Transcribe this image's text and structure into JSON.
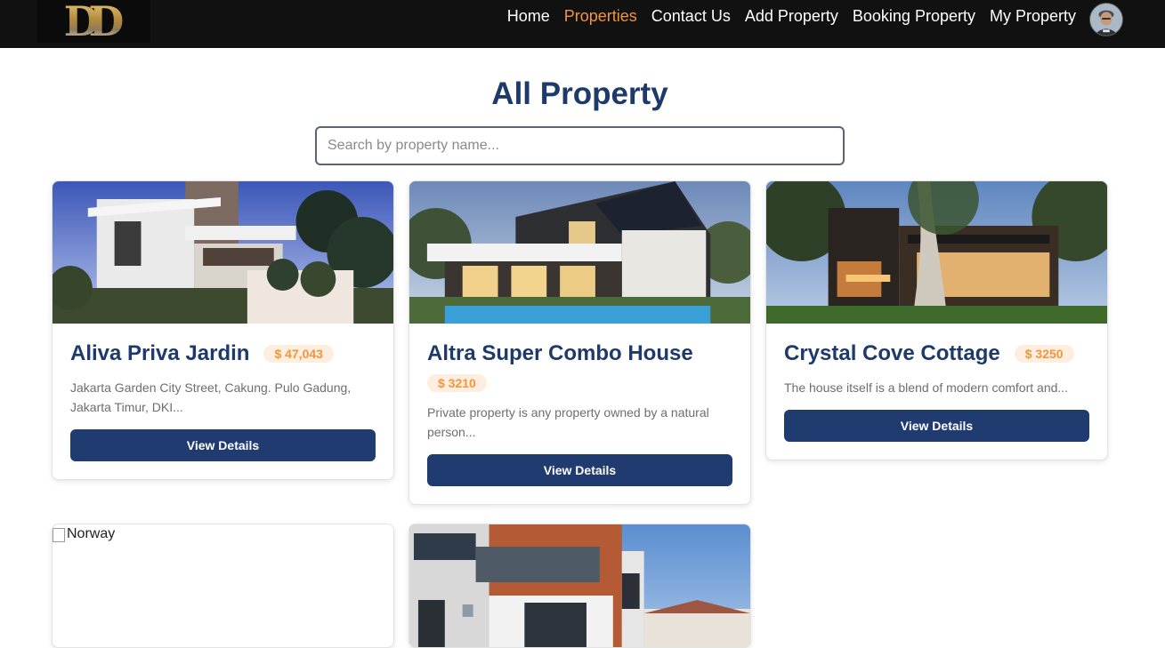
{
  "navbar": {
    "logo_text": "DD",
    "links": [
      {
        "label": "Home",
        "active": false
      },
      {
        "label": "Properties",
        "active": true
      },
      {
        "label": "Contact Us",
        "active": false
      },
      {
        "label": "Add Property",
        "active": false
      },
      {
        "label": "Booking Property",
        "active": false
      },
      {
        "label": "My Property",
        "active": false
      }
    ],
    "active_color": "#f2953b"
  },
  "page": {
    "title": "All Property"
  },
  "search": {
    "placeholder": "Search by property name..."
  },
  "properties": [
    {
      "name": "Aliva Priva Jardin",
      "price": "$ 47,043",
      "description": "Jakarta Garden City Street, Cakung. Pulo Gadung, Jakarta Timur, DKI...",
      "button_label": "View Details"
    },
    {
      "name": "Altra Super Combo House",
      "price": "$ 3210",
      "description": "Private property is any property owned by a natural person...",
      "button_label": "View Details"
    },
    {
      "name": "Crystal Cove Cottage",
      "price": "$ 3250",
      "description": "The house itself is a blend of modern comfort and...",
      "button_label": "View Details"
    },
    {
      "image_alt": "Norway"
    }
  ],
  "colors": {
    "navy": "#1e3a6a",
    "button": "#1f3b70",
    "accent": "#f2953b",
    "price_bg": "#fdeedf"
  }
}
